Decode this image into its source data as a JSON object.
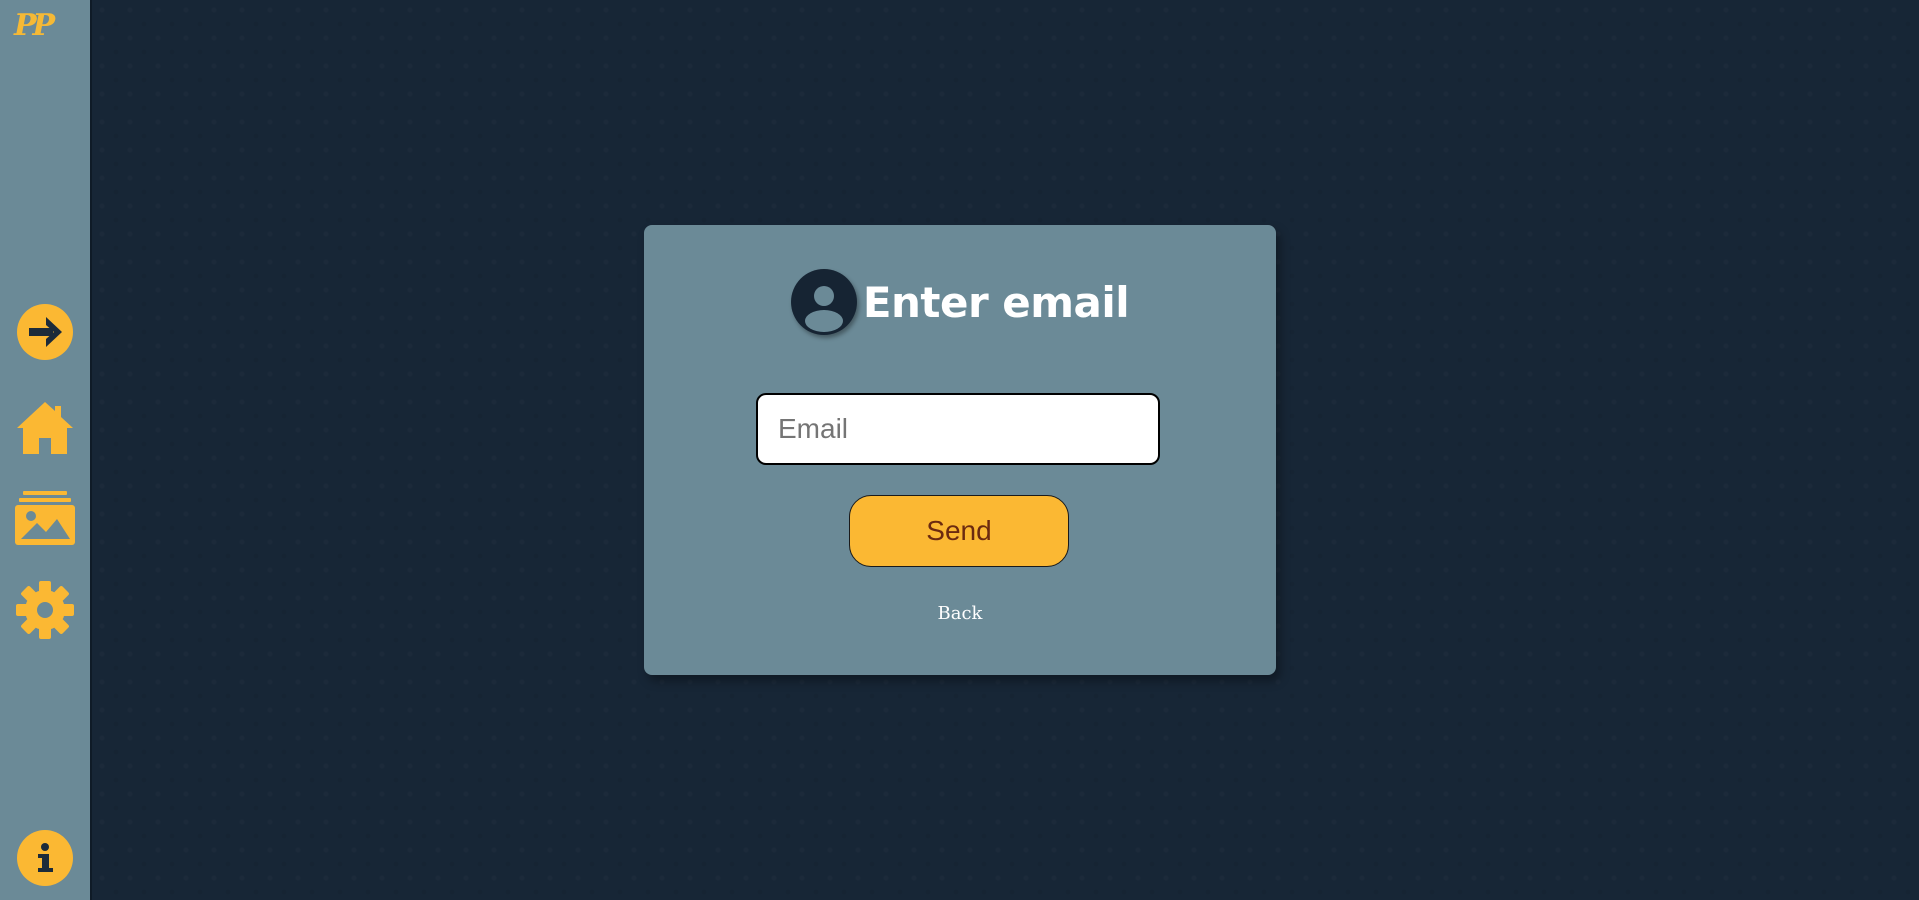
{
  "sidebar": {
    "logo_text": "PP",
    "items": [
      {
        "icon": "arrow-right-circle-icon"
      },
      {
        "icon": "home-icon"
      },
      {
        "icon": "gallery-icon"
      },
      {
        "icon": "gear-icon"
      },
      {
        "icon": "info-icon"
      }
    ]
  },
  "card": {
    "title": "Enter email",
    "email_placeholder": "Email",
    "email_value": "",
    "send_label": "Send",
    "back_label": "Back"
  },
  "colors": {
    "background": "#172636",
    "sidebar": "#6b8a97",
    "card": "#6b8a97",
    "accent": "#fbb833",
    "button_text": "#6b2a10"
  }
}
